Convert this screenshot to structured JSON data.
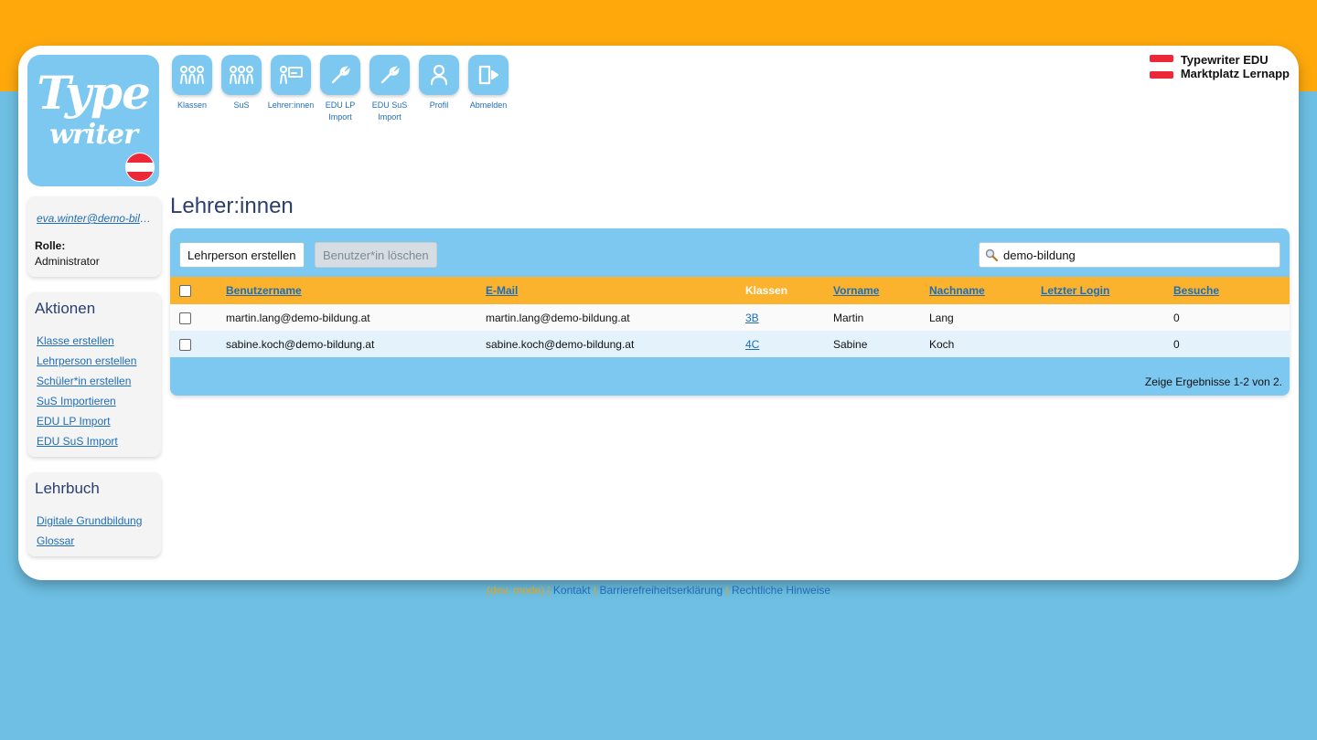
{
  "colors": {
    "accent_orange": "#fea80c",
    "background_blue": "#6ebfe3",
    "tile_blue": "#7cc8f0",
    "header_orange": "#fbb32d",
    "link_blue": "#1e6db8",
    "title_navy": "#2a3e72"
  },
  "logo": {
    "line1": "Type",
    "line2": "writer"
  },
  "nav": [
    {
      "label": "Klassen",
      "icon": "group-icon"
    },
    {
      "label": "SuS",
      "icon": "students-icon"
    },
    {
      "label": "Lehrer:innen",
      "icon": "teacher-board-icon"
    },
    {
      "label": "EDU LP Import",
      "icon": "wrench-icon"
    },
    {
      "label": "EDU SuS Import",
      "icon": "wrench-icon"
    },
    {
      "label": "Profil",
      "icon": "person-icon"
    },
    {
      "label": "Abmelden",
      "icon": "logout-door-icon"
    }
  ],
  "brand": {
    "line1": "Typewriter EDU",
    "line2": "Marktplatz Lernapp"
  },
  "user": {
    "email": "eva.winter@demo-bildung.at",
    "role_label": "Rolle:",
    "role_value": "Administrator"
  },
  "actions": {
    "title": "Aktionen",
    "links": [
      "Klasse erstellen",
      "Lehrperson erstellen",
      "Schüler*in erstellen",
      "SuS Importieren",
      "EDU LP Import",
      "EDU SuS Import"
    ]
  },
  "lehrbuch": {
    "title": "Lehrbuch",
    "links": [
      "Digitale Grundbildung",
      "Glossar"
    ]
  },
  "page": {
    "title": "Lehrer:innen"
  },
  "toolbar": {
    "create_label": "Lehrperson erstellen",
    "delete_label": "Benutzer*in löschen"
  },
  "search": {
    "value": "demo-bildung"
  },
  "table": {
    "columns": [
      "Benutzername",
      "E-Mail",
      "Klassen",
      "Vorname",
      "Nachname",
      "Letzter Login",
      "Besuche"
    ],
    "rows": [
      {
        "username": "martin.lang@demo-bildung.at",
        "email": "martin.lang@demo-bildung.at",
        "klasse": "3B",
        "vorname": "Martin",
        "nachname": "Lang",
        "login": "",
        "besuche": "0"
      },
      {
        "username": "sabine.koch@demo-bildung.at",
        "email": "sabine.koch@demo-bildung.at",
        "klasse": "4C",
        "vorname": "Sabine",
        "nachname": "Koch",
        "login": "",
        "besuche": "0"
      }
    ],
    "result_info": "Zeige Ergebnisse 1-2 von 2."
  },
  "footer": {
    "first": "(dev, mode)",
    "links": [
      "Kontakt",
      "Barrierefreiheitserklärung",
      "Rechtliche Hinweise"
    ]
  }
}
